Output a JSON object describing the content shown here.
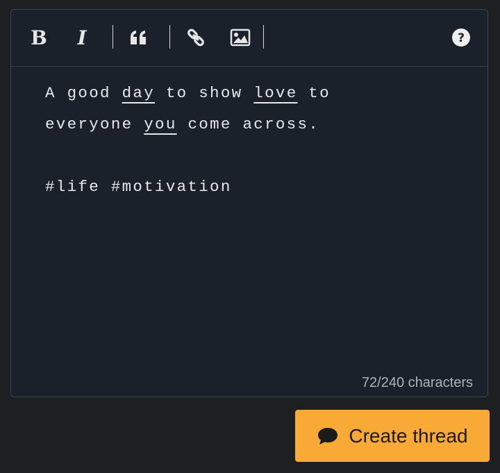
{
  "toolbar": {
    "bold_label": "B",
    "italic_label": "I",
    "icons": [
      "bold-icon",
      "italic-icon",
      "quote-icon",
      "link-icon",
      "image-icon",
      "help-icon"
    ]
  },
  "editor": {
    "lines": [
      {
        "segments": [
          {
            "text": "A good ",
            "underline": false
          },
          {
            "text": "day",
            "underline": true
          },
          {
            "text": " to show ",
            "underline": false
          },
          {
            "text": "love",
            "underline": true
          },
          {
            "text": " to",
            "underline": false
          }
        ]
      },
      {
        "segments": [
          {
            "text": "everyone ",
            "underline": false
          },
          {
            "text": "you",
            "underline": true
          },
          {
            "text": " come across.",
            "underline": false
          }
        ]
      },
      {
        "segments": [
          {
            "text": "",
            "underline": false
          }
        ]
      },
      {
        "segments": [
          {
            "text": "#life #motivation",
            "underline": false
          }
        ]
      }
    ],
    "counter": "72/240 characters"
  },
  "create_button": {
    "label": "Create thread",
    "icon": "chat-bubble-icon"
  },
  "colors": {
    "background": "#1e1f21",
    "editor_bg": "#1a212b",
    "button_bg": "#f9a935"
  }
}
